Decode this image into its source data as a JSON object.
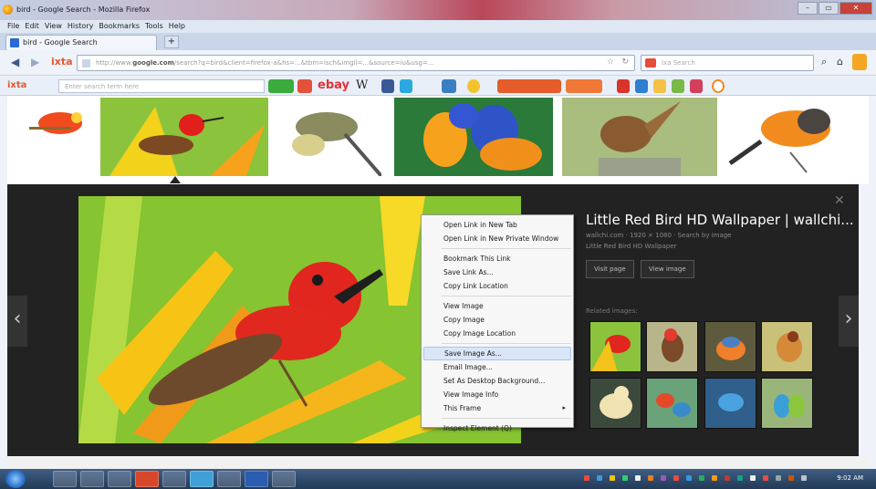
{
  "window": {
    "title": "bird - Google Search - Mozilla Firefox",
    "controls": [
      "–",
      "▭",
      "✕"
    ]
  },
  "menubar": [
    "File",
    "Edit",
    "View",
    "History",
    "Bookmarks",
    "Tools",
    "Help"
  ],
  "tab": {
    "label": "bird - Google Search",
    "new_tab": "+"
  },
  "navbar": {
    "url_prefix": "http://www.",
    "url_domain": "google.com",
    "url_rest": "/search?q=bird&client=firefox-a&hs=...&tbm=isch&imgil=...&source=iu&usg=...",
    "search_placeholder": "Ixa Search"
  },
  "toolbar2": {
    "brand": "ixta",
    "input_placeholder": "Enter search term here",
    "ebay": "ebay",
    "wiki": "W"
  },
  "preview": {
    "title": "Little Red Bird HD Wallpaper | wallchi...",
    "source": "wallchi.com · 1920 × 1080 · Search by image",
    "desc": "Little Red Bird HD Wallpaper",
    "btn_visit": "Visit page",
    "btn_view": "View image",
    "related_label": "Related images:",
    "close": "✕",
    "prev": "‹",
    "next": "›"
  },
  "context_menu": {
    "groups": [
      [
        "Open Link in New Tab",
        "Open Link in New Private Window"
      ],
      [
        "Bookmark This Link",
        "Save Link As...",
        "Copy Link Location"
      ],
      [
        "View Image",
        "Copy Image",
        "Copy Image Location"
      ],
      [
        "Save Image As...",
        "Email Image...",
        "Set As Desktop Background...",
        "View Image Info",
        "This Frame"
      ],
      [
        "Inspect Element (Q)"
      ]
    ],
    "highlighted": "Save Image As...",
    "submenu_item": "This Frame",
    "submenu_arrow": "▸"
  },
  "taskbar": {
    "clock": "9:02 AM"
  }
}
